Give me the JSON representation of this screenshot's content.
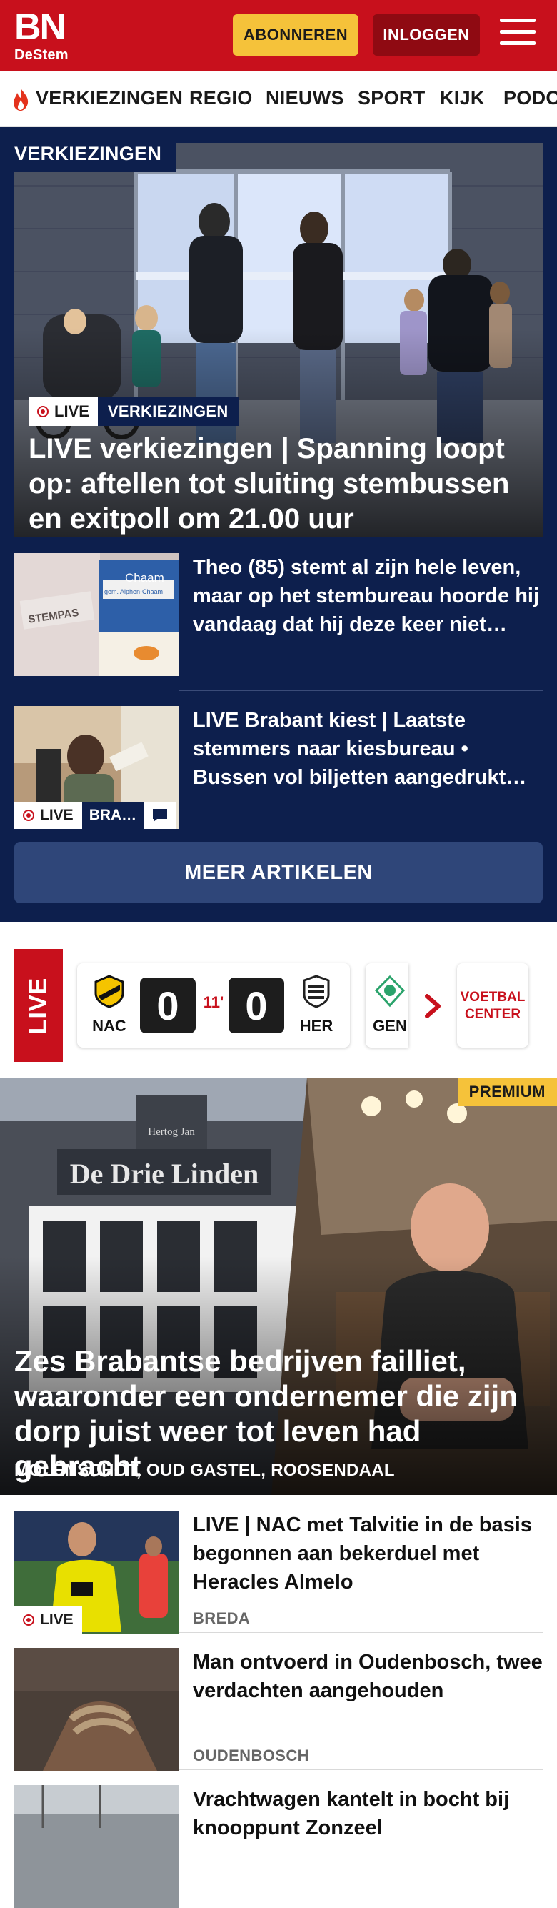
{
  "header": {
    "logo_bn": "BN",
    "logo_destem": "DeStem",
    "subscribe_label": "ABONNEREN",
    "login_label": "INLOGGEN",
    "brand_color": "#c8101c"
  },
  "nav": {
    "items": [
      "VERKIEZINGEN",
      "REGIO",
      "NIEUWS",
      "SPORT",
      "KIJK",
      "PODC"
    ]
  },
  "elections": {
    "section_label": "VERKIEZINGEN",
    "background": "#0d1f4d",
    "hero": {
      "live_label": "LIVE",
      "category": "VERKIEZINGEN",
      "title": "LIVE verkiezingen | Spanning loopt op: aftellen tot sluiting stembussen en exitpoll om 21.00 uur"
    },
    "items": [
      {
        "title": "Theo (85) stemt al zijn hele leven, maar op het stembureau hoorde hij vandaag dat hij deze keer niet…"
      },
      {
        "title": "LIVE Brabant kiest | Laatste stemmers naar kiesbureau • Bussen vol biljetten aangedrukt…",
        "live_label": "LIVE",
        "category": "BRA…"
      }
    ],
    "more_label": "MEER ARTIKELEN"
  },
  "scores": {
    "live_label": "LIVE",
    "match": {
      "home": "NAC",
      "away": "HER",
      "home_score": "0",
      "away_score": "0",
      "minute": "11'"
    },
    "next_team": "GEN",
    "center_label_1": "VOETBAL",
    "center_label_2": "CENTER"
  },
  "feature": {
    "premium_label": "PREMIUM",
    "title": "Zes Brabantse bedrijven failliet, waaronder een ondernemer die zijn dorp juist weer tot leven had gebracht",
    "location": "MOLENSCHOT, OUD GASTEL, ROOSENDAAL",
    "sign_text": "De Drie Linden",
    "sign_small": "Hertog Jan"
  },
  "articles": [
    {
      "title": "LIVE | NAC met Talvitie in de basis begonnen aan bekerduel met Heracles Almelo",
      "location": "BREDA",
      "live_label": "LIVE"
    },
    {
      "title": "Man ontvoerd in Oudenbosch, twee verdachten aangehouden",
      "location": "OUDENBOSCH"
    },
    {
      "title": "Vrachtwagen kantelt in bocht bij knooppunt Zonzeel"
    }
  ],
  "thumb_texts": {
    "stempas": "STEMPAS",
    "chaam": "Chaam",
    "chaam_sub": "gem. Alphen-Chaam"
  }
}
